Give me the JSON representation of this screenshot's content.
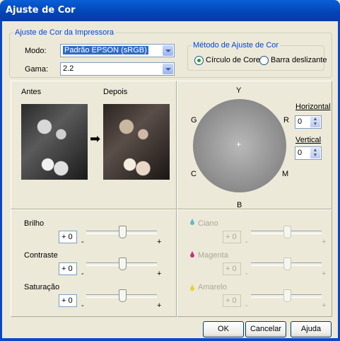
{
  "window": {
    "title": "Ajuste de Cor"
  },
  "printer_group": {
    "legend": "Ajuste de Cor da Impressora",
    "mode_label": "Modo:",
    "mode_value": "Padrão EPSON (sRGB)",
    "gamma_label": "Gama:",
    "gamma_value": "2.2"
  },
  "method_group": {
    "legend": "Método de Ajuste de Cor",
    "option_circle": "Círculo de Cores",
    "option_bar": "Barra deslizante",
    "selected": "option_circle"
  },
  "preview": {
    "before_label": "Antes",
    "after_label": "Depois"
  },
  "color_wheel": {
    "labels": {
      "top": "Y",
      "right_top": "R",
      "right_bottom": "M",
      "bottom": "B",
      "left_bottom": "C",
      "left_top": "G"
    },
    "horizontal_label": "Horizontal",
    "horizontal_value": "0",
    "vertical_label": "Vertical",
    "vertical_value": "0"
  },
  "sliders_left": [
    {
      "label": "Brilho",
      "value": "+ 0",
      "minus": "-",
      "plus": "+",
      "level": 0.5
    },
    {
      "label": "Contraste",
      "value": "+ 0",
      "minus": "-",
      "plus": "+",
      "level": 0.5
    },
    {
      "label": "Saturação",
      "value": "+ 0",
      "minus": "-",
      "plus": "+",
      "level": 0.5
    }
  ],
  "sliders_right": [
    {
      "label": "Ciano",
      "value": "+ 0",
      "minus": "-",
      "plus": "+",
      "level": 0.5,
      "color": "#5bb8d6"
    },
    {
      "label": "Magenta",
      "value": "+ 0",
      "minus": "-",
      "plus": "+",
      "level": 0.5,
      "color": "#c03080"
    },
    {
      "label": "Amarelo",
      "value": "+ 0",
      "minus": "-",
      "plus": "+",
      "level": 0.5,
      "color": "#e6d12a"
    }
  ],
  "buttons": {
    "ok": "OK",
    "cancel": "Cancelar",
    "help": "Ajuda"
  }
}
